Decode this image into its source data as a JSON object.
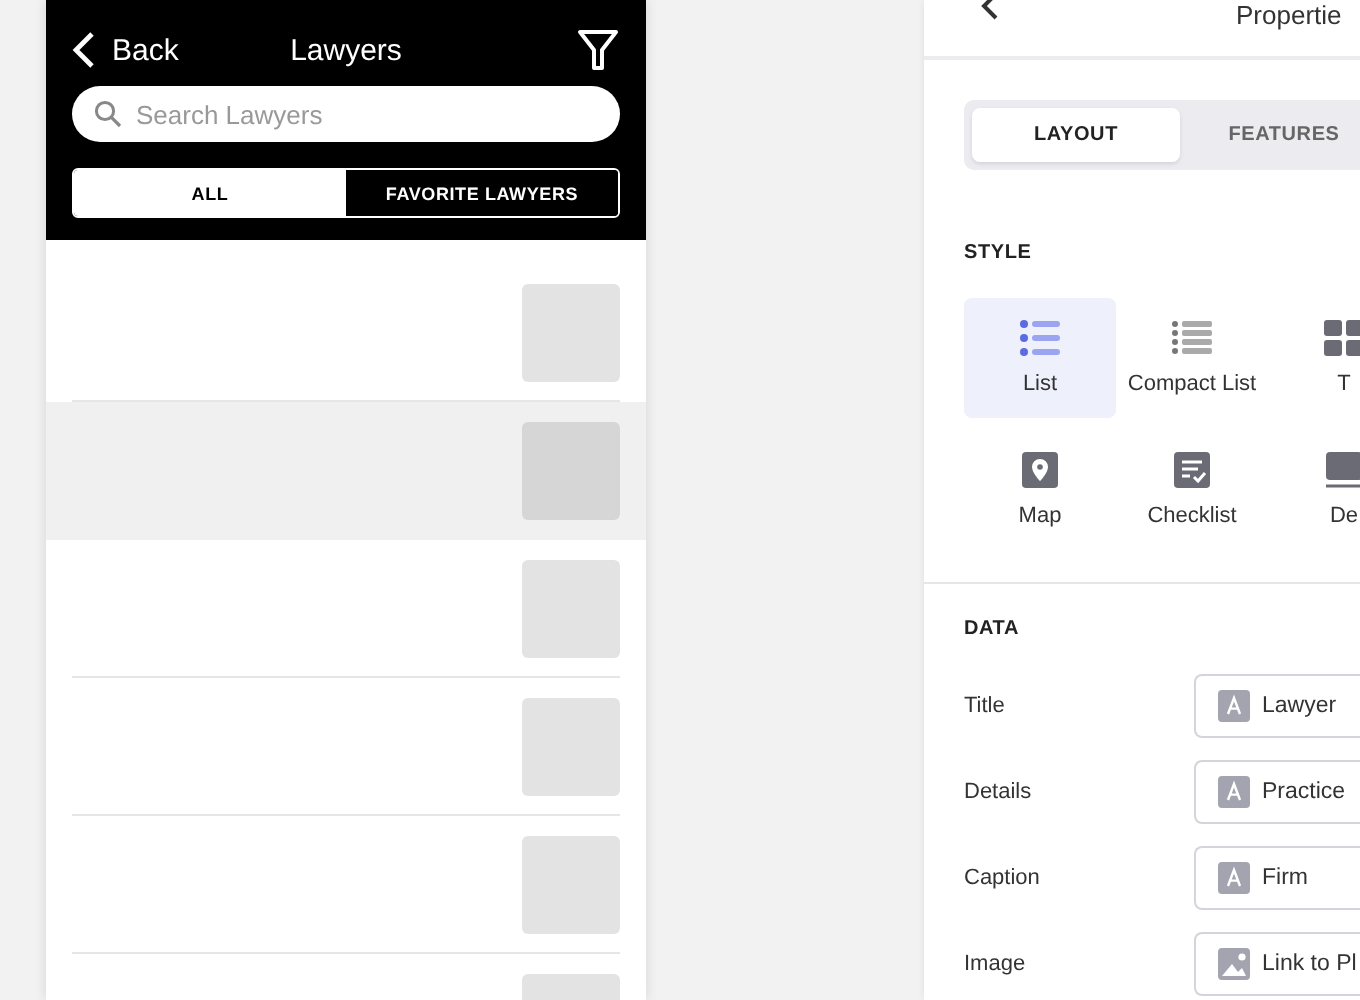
{
  "phone": {
    "back": "Back",
    "title": "Lawyers",
    "search": {
      "placeholder": "Search Lawyers"
    },
    "segments": [
      {
        "label": "ALL",
        "selected": true
      },
      {
        "label": "FAVORITE LAWYERS",
        "selected": false
      }
    ],
    "rows": [
      {
        "selected": false
      },
      {
        "selected": true
      },
      {
        "selected": false
      },
      {
        "selected": false
      },
      {
        "selected": false
      },
      {
        "selected": false
      }
    ]
  },
  "properties": {
    "title": "Propertie",
    "tabs": [
      {
        "label": "LAYOUT",
        "selected": true
      },
      {
        "label": "FEATURES",
        "selected": false
      }
    ],
    "style_heading": "STYLE",
    "styles": [
      {
        "label": "List",
        "kind": "list",
        "selected": true
      },
      {
        "label": "Compact List",
        "kind": "compact",
        "selected": false
      },
      {
        "label": "T",
        "kind": "tiles",
        "selected": false
      },
      {
        "label": "Map",
        "kind": "map",
        "selected": false
      },
      {
        "label": "Checklist",
        "kind": "checklist",
        "selected": false
      },
      {
        "label": "De",
        "kind": "detail",
        "selected": false
      }
    ],
    "data_heading": "DATA",
    "fields": [
      {
        "label": "Title",
        "value": "Lawyer",
        "kind": "text"
      },
      {
        "label": "Details",
        "value": "Practice",
        "kind": "text"
      },
      {
        "label": "Caption",
        "value": "Firm",
        "kind": "text"
      },
      {
        "label": "Image",
        "value": "Link to Pl",
        "kind": "image"
      }
    ]
  }
}
